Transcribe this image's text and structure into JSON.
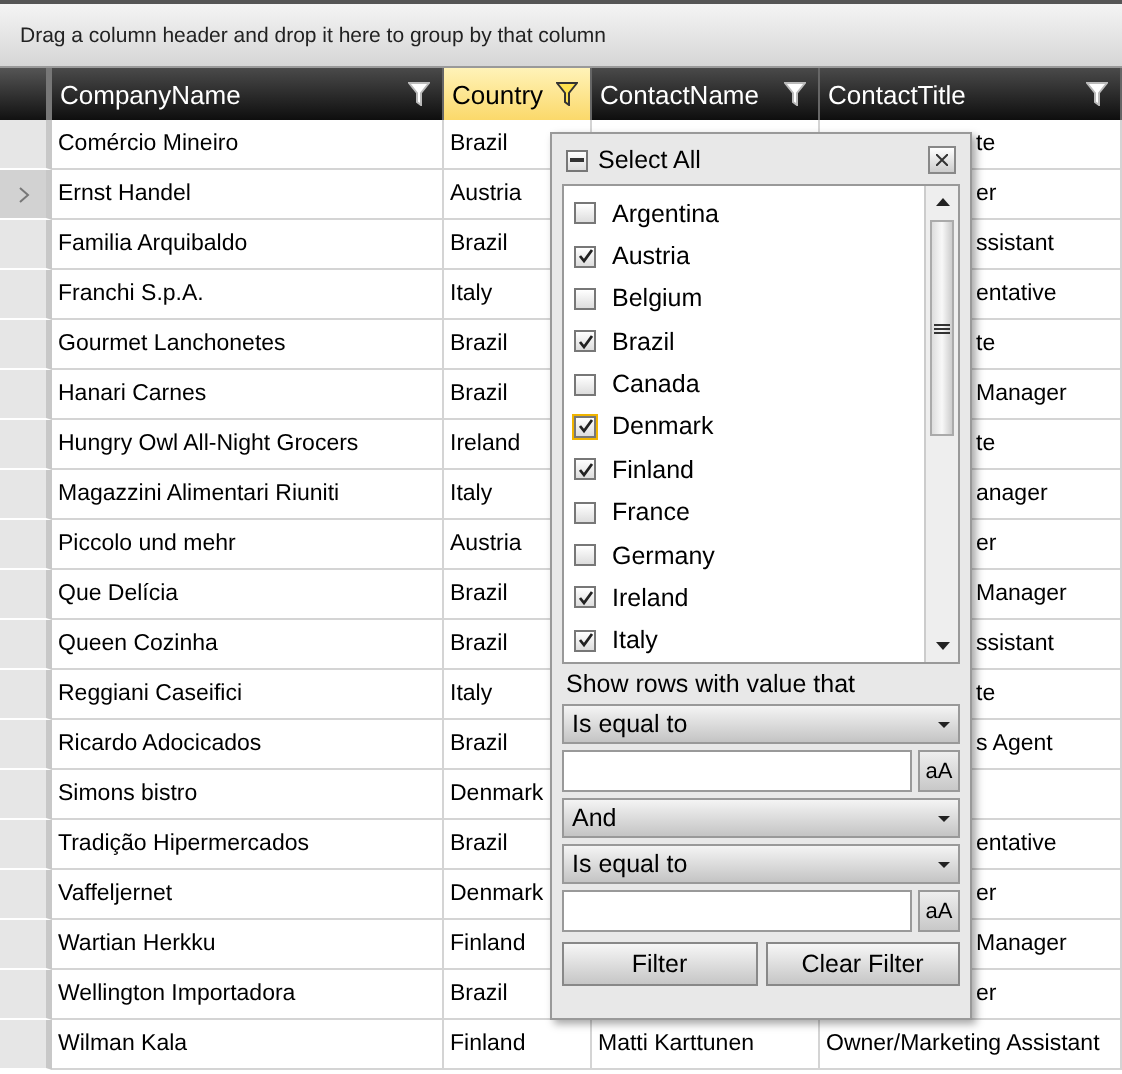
{
  "group_panel": {
    "hint": "Drag a column header and drop it here to group by that column"
  },
  "columns": [
    {
      "label": "CompanyName",
      "filtered": false
    },
    {
      "label": "Country",
      "filtered": true
    },
    {
      "label": "ContactName",
      "filtered": false
    },
    {
      "label": "ContactTitle",
      "filtered": false
    }
  ],
  "rows": [
    {
      "selected": false,
      "company": "Comércio Mineiro",
      "country": "Brazil",
      "contact_title": "te"
    },
    {
      "selected": true,
      "company": "Ernst Handel",
      "country": "Austria",
      "contact_title": "er"
    },
    {
      "selected": false,
      "company": "Familia Arquibaldo",
      "country": "Brazil",
      "contact_title": "ssistant"
    },
    {
      "selected": false,
      "company": "Franchi S.p.A.",
      "country": "Italy",
      "contact_title": "entative"
    },
    {
      "selected": false,
      "company": "Gourmet Lanchonetes",
      "country": "Brazil",
      "contact_title": "te"
    },
    {
      "selected": false,
      "company": "Hanari Carnes",
      "country": "Brazil",
      "contact_title": "Manager"
    },
    {
      "selected": false,
      "company": "Hungry Owl All-Night Grocers",
      "country": "Ireland",
      "contact_title": "te"
    },
    {
      "selected": false,
      "company": "Magazzini Alimentari Riuniti",
      "country": "Italy",
      "contact_title": "anager"
    },
    {
      "selected": false,
      "company": "Piccolo und mehr",
      "country": "Austria",
      "contact_title": "er"
    },
    {
      "selected": false,
      "company": "Que Delícia",
      "country": "Brazil",
      "contact_title": "Manager"
    },
    {
      "selected": false,
      "company": "Queen Cozinha",
      "country": "Brazil",
      "contact_title": "ssistant"
    },
    {
      "selected": false,
      "company": "Reggiani Caseifici",
      "country": "Italy",
      "contact_title": "te"
    },
    {
      "selected": false,
      "company": "Ricardo Adocicados",
      "country": "Brazil",
      "contact_title": "s Agent"
    },
    {
      "selected": false,
      "company": "Simons bistro",
      "country": "Denmark"
    },
    {
      "selected": false,
      "company": "Tradição Hipermercados",
      "country": "Brazil",
      "contact_title": "entative"
    },
    {
      "selected": false,
      "company": "Vaffeljernet",
      "country": "Denmark",
      "contact_title": "er"
    },
    {
      "selected": false,
      "company": "Wartian Herkku",
      "country": "Finland",
      "contact_title": "Manager"
    },
    {
      "selected": false,
      "company": "Wellington Importadora",
      "country": "Brazil",
      "contact_title": "er"
    },
    {
      "selected": false,
      "company": "Wilman Kala",
      "country": "Finland",
      "contact_name": "Matti Karttunen",
      "contact_title": "Owner/Marketing Assistant"
    }
  ],
  "filter_popup": {
    "select_all": {
      "label": "Select All",
      "indeterminate": true
    },
    "items": [
      {
        "label": "Argentina",
        "checked": false,
        "focused": false
      },
      {
        "label": "Austria",
        "checked": true,
        "focused": false
      },
      {
        "label": "Belgium",
        "checked": false,
        "focused": false
      },
      {
        "label": "Brazil",
        "checked": true,
        "focused": false
      },
      {
        "label": "Canada",
        "checked": false,
        "focused": false
      },
      {
        "label": "Denmark",
        "checked": true,
        "focused": true
      },
      {
        "label": "Finland",
        "checked": true,
        "focused": false
      },
      {
        "label": "France",
        "checked": false,
        "focused": false
      },
      {
        "label": "Germany",
        "checked": false,
        "focused": false
      },
      {
        "label": "Ireland",
        "checked": true,
        "focused": false
      },
      {
        "label": "Italy",
        "checked": true,
        "focused": false
      }
    ],
    "condition_label": "Show rows with value that",
    "operator_1": {
      "value": "Is equal to"
    },
    "case_button_1": "aA",
    "logic": {
      "value": "And"
    },
    "operator_2": {
      "value": "Is equal to"
    },
    "case_button_2": "aA",
    "buttons": [
      "Filter",
      "Clear Filter"
    ]
  }
}
